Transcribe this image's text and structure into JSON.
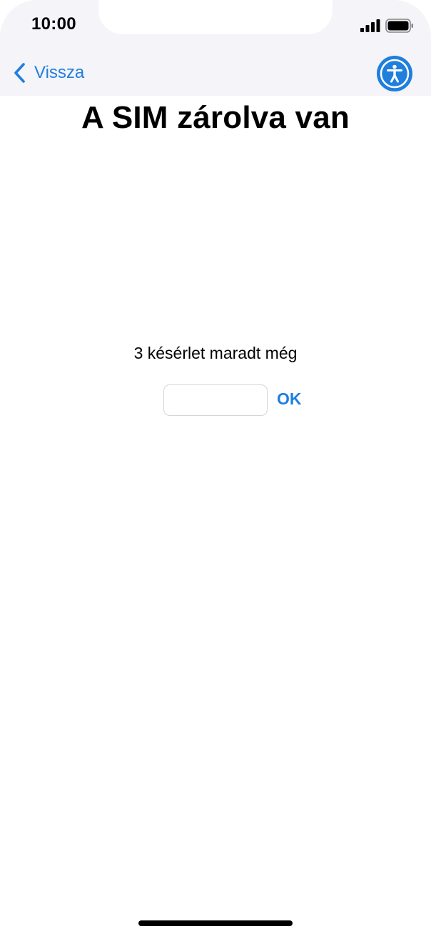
{
  "status_bar": {
    "time": "10:00",
    "signal_icon": "cellular-signal-icon",
    "battery_icon": "battery-full-icon"
  },
  "nav": {
    "back_label": "Vissza",
    "back_icon": "chevron-left-icon",
    "accessibility_icon": "accessibility-icon"
  },
  "main": {
    "title": "A SIM zárolva van",
    "attempts_text": "3 késérlet maradt még",
    "pin_input": {
      "value": "",
      "placeholder": ""
    },
    "ok_label": "OK"
  },
  "colors": {
    "accent": "#1f7fdd",
    "top_bar_background": "#f4f4f9",
    "text": "#000000"
  }
}
